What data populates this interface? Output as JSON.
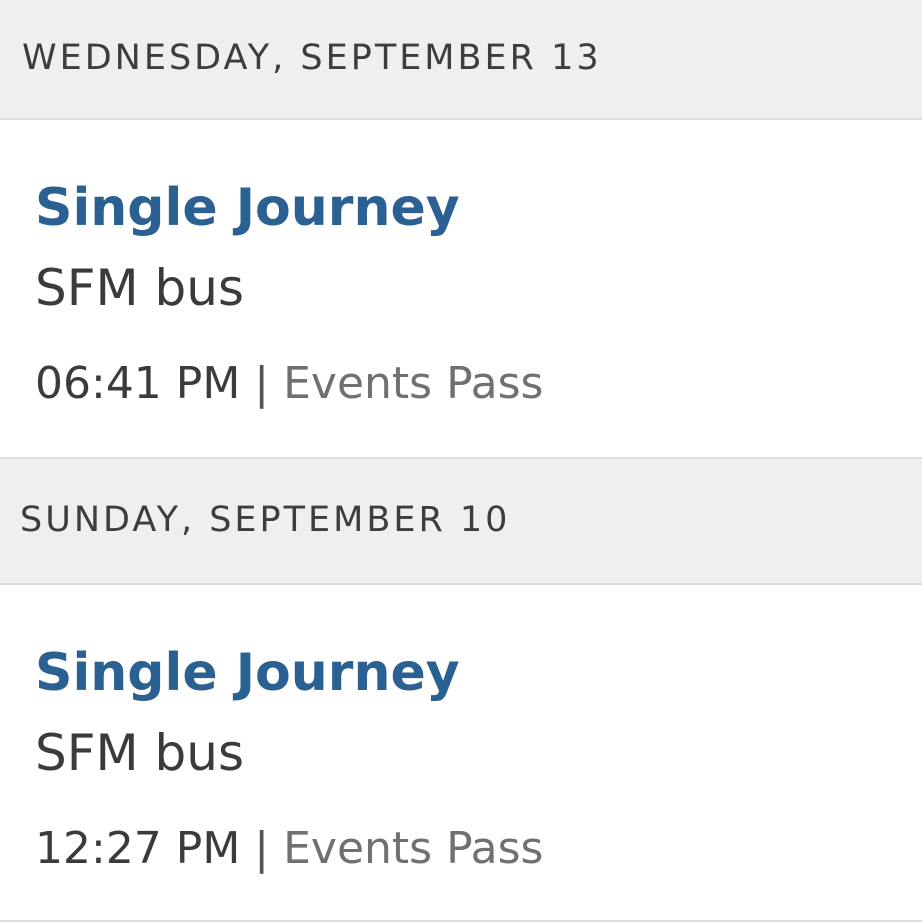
{
  "trips": [
    {
      "date": "WEDNESDAY, SEPTEMBER 13",
      "title": "Single Journey",
      "mode": "SFM bus",
      "time": "06:41 PM",
      "separator": "|",
      "pass": "Events Pass"
    },
    {
      "date": "SUNDAY, SEPTEMBER 10",
      "title": "Single Journey",
      "mode": "SFM bus",
      "time": "12:27 PM",
      "separator": "|",
      "pass": "Events Pass"
    }
  ],
  "colors": {
    "header_bg": "#efefef",
    "title": "#2a6092",
    "text": "#3b3b3b",
    "muted": "#707070"
  }
}
